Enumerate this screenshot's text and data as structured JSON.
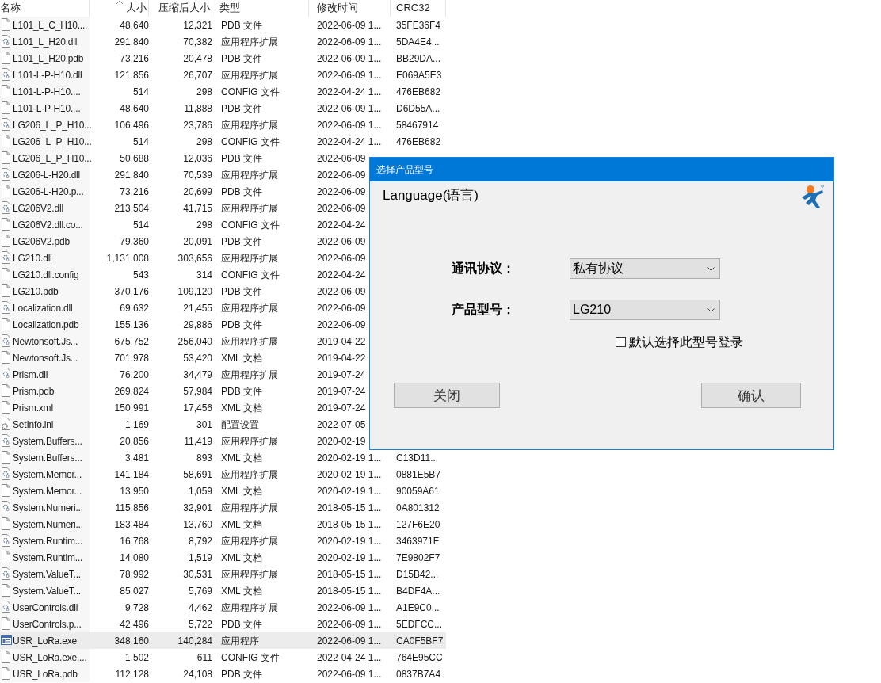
{
  "table": {
    "columns": [
      "名称",
      "大小",
      "压缩后大小",
      "类型",
      "修改时间",
      "CRC32"
    ],
    "rows": [
      {
        "kind": "file",
        "name": "L101_L_C_H10....",
        "size": "48,640",
        "packed": "12,321",
        "type": "PDB 文件",
        "modified": "2022-06-09 1...",
        "crc": "35FE36F4",
        "selected": false
      },
      {
        "kind": "dll",
        "name": "L101_L_H20.dll",
        "size": "291,840",
        "packed": "70,382",
        "type": "应用程序扩展",
        "modified": "2022-06-09 1...",
        "crc": "5DA4E4...",
        "selected": false
      },
      {
        "kind": "file",
        "name": "L101_L_H20.pdb",
        "size": "73,216",
        "packed": "20,478",
        "type": "PDB 文件",
        "modified": "2022-06-09 1...",
        "crc": "BB29DA...",
        "selected": false
      },
      {
        "kind": "dll",
        "name": "L101-L-P-H10.dll",
        "size": "121,856",
        "packed": "26,707",
        "type": "应用程序扩展",
        "modified": "2022-06-09 1...",
        "crc": "E069A5E3",
        "selected": false
      },
      {
        "kind": "file",
        "name": "L101-L-P-H10....",
        "size": "514",
        "packed": "298",
        "type": "CONFIG 文件",
        "modified": "2022-04-24 1...",
        "crc": "476EB682",
        "selected": false
      },
      {
        "kind": "file",
        "name": "L101-L-P-H10....",
        "size": "48,640",
        "packed": "11,888",
        "type": "PDB 文件",
        "modified": "2022-06-09 1...",
        "crc": "D6D55A...",
        "selected": false
      },
      {
        "kind": "dll",
        "name": "LG206_L_P_H10...",
        "size": "106,496",
        "packed": "23,786",
        "type": "应用程序扩展",
        "modified": "2022-06-09 1...",
        "crc": "58467914",
        "selected": false
      },
      {
        "kind": "file",
        "name": "LG206_L_P_H10...",
        "size": "514",
        "packed": "298",
        "type": "CONFIG 文件",
        "modified": "2022-04-24 1...",
        "crc": "476EB682",
        "selected": false
      },
      {
        "kind": "file",
        "name": "LG206_L_P_H10...",
        "size": "50,688",
        "packed": "12,036",
        "type": "PDB 文件",
        "modified": "2022-06-09",
        "selected": false
      },
      {
        "kind": "dll",
        "name": "LG206-L-H20.dll",
        "size": "291,840",
        "packed": "70,539",
        "type": "应用程序扩展",
        "modified": "2022-06-09",
        "selected": false
      },
      {
        "kind": "file",
        "name": "LG206-L-H20.p...",
        "size": "73,216",
        "packed": "20,699",
        "type": "PDB 文件",
        "modified": "2022-06-09",
        "selected": false
      },
      {
        "kind": "dll",
        "name": "LG206V2.dll",
        "size": "213,504",
        "packed": "41,715",
        "type": "应用程序扩展",
        "modified": "2022-06-09",
        "selected": false
      },
      {
        "kind": "file",
        "name": "LG206V2.dll.co...",
        "size": "514",
        "packed": "298",
        "type": "CONFIG 文件",
        "modified": "2022-04-24",
        "selected": false
      },
      {
        "kind": "file",
        "name": "LG206V2.pdb",
        "size": "79,360",
        "packed": "20,091",
        "type": "PDB 文件",
        "modified": "2022-06-09",
        "selected": false
      },
      {
        "kind": "dll",
        "name": "LG210.dll",
        "size": "1,131,008",
        "packed": "303,656",
        "type": "应用程序扩展",
        "modified": "2022-06-09",
        "selected": false
      },
      {
        "kind": "file",
        "name": "LG210.dll.config",
        "size": "543",
        "packed": "314",
        "type": "CONFIG 文件",
        "modified": "2022-04-24",
        "selected": false
      },
      {
        "kind": "file",
        "name": "LG210.pdb",
        "size": "370,176",
        "packed": "109,120",
        "type": "PDB 文件",
        "modified": "2022-06-09",
        "selected": false
      },
      {
        "kind": "dll",
        "name": "Localization.dll",
        "size": "69,632",
        "packed": "21,455",
        "type": "应用程序扩展",
        "modified": "2022-06-09",
        "selected": false
      },
      {
        "kind": "file",
        "name": "Localization.pdb",
        "size": "155,136",
        "packed": "29,886",
        "type": "PDB 文件",
        "modified": "2022-06-09",
        "selected": false
      },
      {
        "kind": "dll",
        "name": "Newtonsoft.Js...",
        "size": "675,752",
        "packed": "256,040",
        "type": "应用程序扩展",
        "modified": "2019-04-22",
        "selected": false
      },
      {
        "kind": "file",
        "name": "Newtonsoft.Js...",
        "size": "701,978",
        "packed": "53,420",
        "type": "XML 文档",
        "modified": "2019-04-22",
        "selected": false
      },
      {
        "kind": "dll",
        "name": "Prism.dll",
        "size": "76,200",
        "packed": "34,479",
        "type": "应用程序扩展",
        "modified": "2019-07-24",
        "selected": false
      },
      {
        "kind": "file",
        "name": "Prism.pdb",
        "size": "269,824",
        "packed": "57,984",
        "type": "PDB 文件",
        "modified": "2019-07-24",
        "selected": false
      },
      {
        "kind": "file",
        "name": "Prism.xml",
        "size": "150,991",
        "packed": "17,456",
        "type": "XML 文档",
        "modified": "2019-07-24",
        "selected": false
      },
      {
        "kind": "ini",
        "name": "SetInfo.ini",
        "size": "1,169",
        "packed": "301",
        "type": "配置设置",
        "modified": "2022-07-05",
        "selected": false
      },
      {
        "kind": "dll",
        "name": "System.Buffers...",
        "size": "20,856",
        "packed": "11,419",
        "type": "应用程序扩展",
        "modified": "2020-02-19",
        "selected": false
      },
      {
        "kind": "file",
        "name": "System.Buffers...",
        "size": "3,481",
        "packed": "893",
        "type": "XML 文档",
        "modified": "2020-02-19 1...",
        "crc": "C13D11...",
        "selected": false
      },
      {
        "kind": "dll",
        "name": "System.Memor...",
        "size": "141,184",
        "packed": "58,691",
        "type": "应用程序扩展",
        "modified": "2020-02-19 1...",
        "crc": "0881E5B7",
        "selected": false
      },
      {
        "kind": "file",
        "name": "System.Memor...",
        "size": "13,950",
        "packed": "1,059",
        "type": "XML 文档",
        "modified": "2020-02-19 1...",
        "crc": "90059A61",
        "selected": false
      },
      {
        "kind": "dll",
        "name": "System.Numeri...",
        "size": "115,856",
        "packed": "32,901",
        "type": "应用程序扩展",
        "modified": "2018-05-15 1...",
        "crc": "0A801312",
        "selected": false
      },
      {
        "kind": "file",
        "name": "System.Numeri...",
        "size": "183,484",
        "packed": "13,760",
        "type": "XML 文档",
        "modified": "2018-05-15 1...",
        "crc": "127F6E20",
        "selected": false
      },
      {
        "kind": "dll",
        "name": "System.Runtim...",
        "size": "16,768",
        "packed": "8,792",
        "type": "应用程序扩展",
        "modified": "2020-02-19 1...",
        "crc": "3463971F",
        "selected": false
      },
      {
        "kind": "file",
        "name": "System.Runtim...",
        "size": "14,080",
        "packed": "1,519",
        "type": "XML 文档",
        "modified": "2020-02-19 1...",
        "crc": "7E9802F7",
        "selected": false
      },
      {
        "kind": "dll",
        "name": "System.ValueT...",
        "size": "78,992",
        "packed": "30,531",
        "type": "应用程序扩展",
        "modified": "2018-05-15 1...",
        "crc": "D15B42...",
        "selected": false
      },
      {
        "kind": "file",
        "name": "System.ValueT...",
        "size": "85,027",
        "packed": "5,769",
        "type": "XML 文档",
        "modified": "2018-05-15 1...",
        "crc": "B4DF4A...",
        "selected": false
      },
      {
        "kind": "dll",
        "name": "UserControls.dll",
        "size": "9,728",
        "packed": "4,462",
        "type": "应用程序扩展",
        "modified": "2022-06-09 1...",
        "crc": "A1E9C0...",
        "selected": false
      },
      {
        "kind": "file",
        "name": "UserControls.p...",
        "size": "42,496",
        "packed": "5,722",
        "type": "PDB 文件",
        "modified": "2022-06-09 1...",
        "crc": "5EDFCC...",
        "selected": false
      },
      {
        "kind": "exe",
        "name": "USR_LoRa.exe",
        "size": "348,160",
        "packed": "140,284",
        "type": "应用程序",
        "modified": "2022-06-09 1...",
        "crc": "CA0F5BF7",
        "selected": true
      },
      {
        "kind": "file",
        "name": "USR_LoRa.exe....",
        "size": "1,502",
        "packed": "611",
        "type": "CONFIG 文件",
        "modified": "2022-04-24 1...",
        "crc": "764E95CC",
        "selected": false
      },
      {
        "kind": "file",
        "name": "USR_LoRa.pdb",
        "size": "112,128",
        "packed": "24,108",
        "type": "PDB 文件",
        "modified": "2022-06-09 1...",
        "crc": "0837B7A4",
        "selected": false
      }
    ]
  },
  "dialog": {
    "title": "选择产品型号",
    "language_label": "Language(语言)",
    "fields": [
      {
        "label": "通讯协议：",
        "value": "私有协议"
      },
      {
        "label": "产品型号：",
        "value": "LG210"
      }
    ],
    "checkbox": {
      "label": "默认选择此型号登录",
      "checked": false
    },
    "buttons": [
      "关闭",
      "确认"
    ]
  }
}
